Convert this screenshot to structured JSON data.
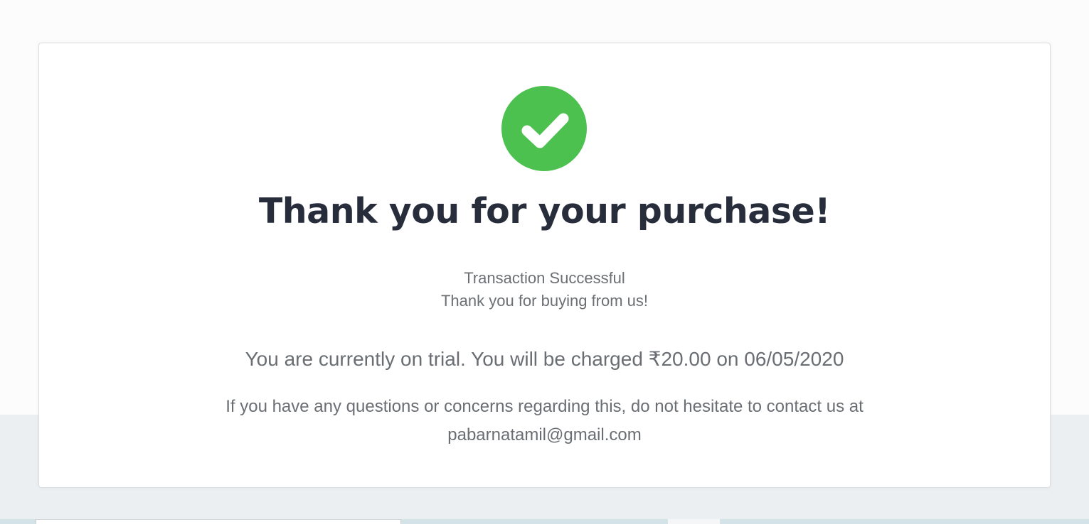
{
  "confirmation": {
    "icon": "check-circle-icon",
    "icon_color": "#4cc14f",
    "title": "Thank you for your purchase!",
    "status_line": "Transaction Successful",
    "thanks_line": "Thank you for buying from us!",
    "trial_message": "You are currently on trial. You will be charged ₹20.00 on 06/05/2020",
    "contact_message": "If you have any questions or concerns regarding this, do not hesitate to contact us at",
    "contact_email": "pabarnatamil@gmail.com"
  },
  "colors": {
    "title": "#272d3b",
    "body_text": "#6a6e73",
    "page_bg": "#fcfcfc",
    "lower_bg": "#ebeff2"
  }
}
